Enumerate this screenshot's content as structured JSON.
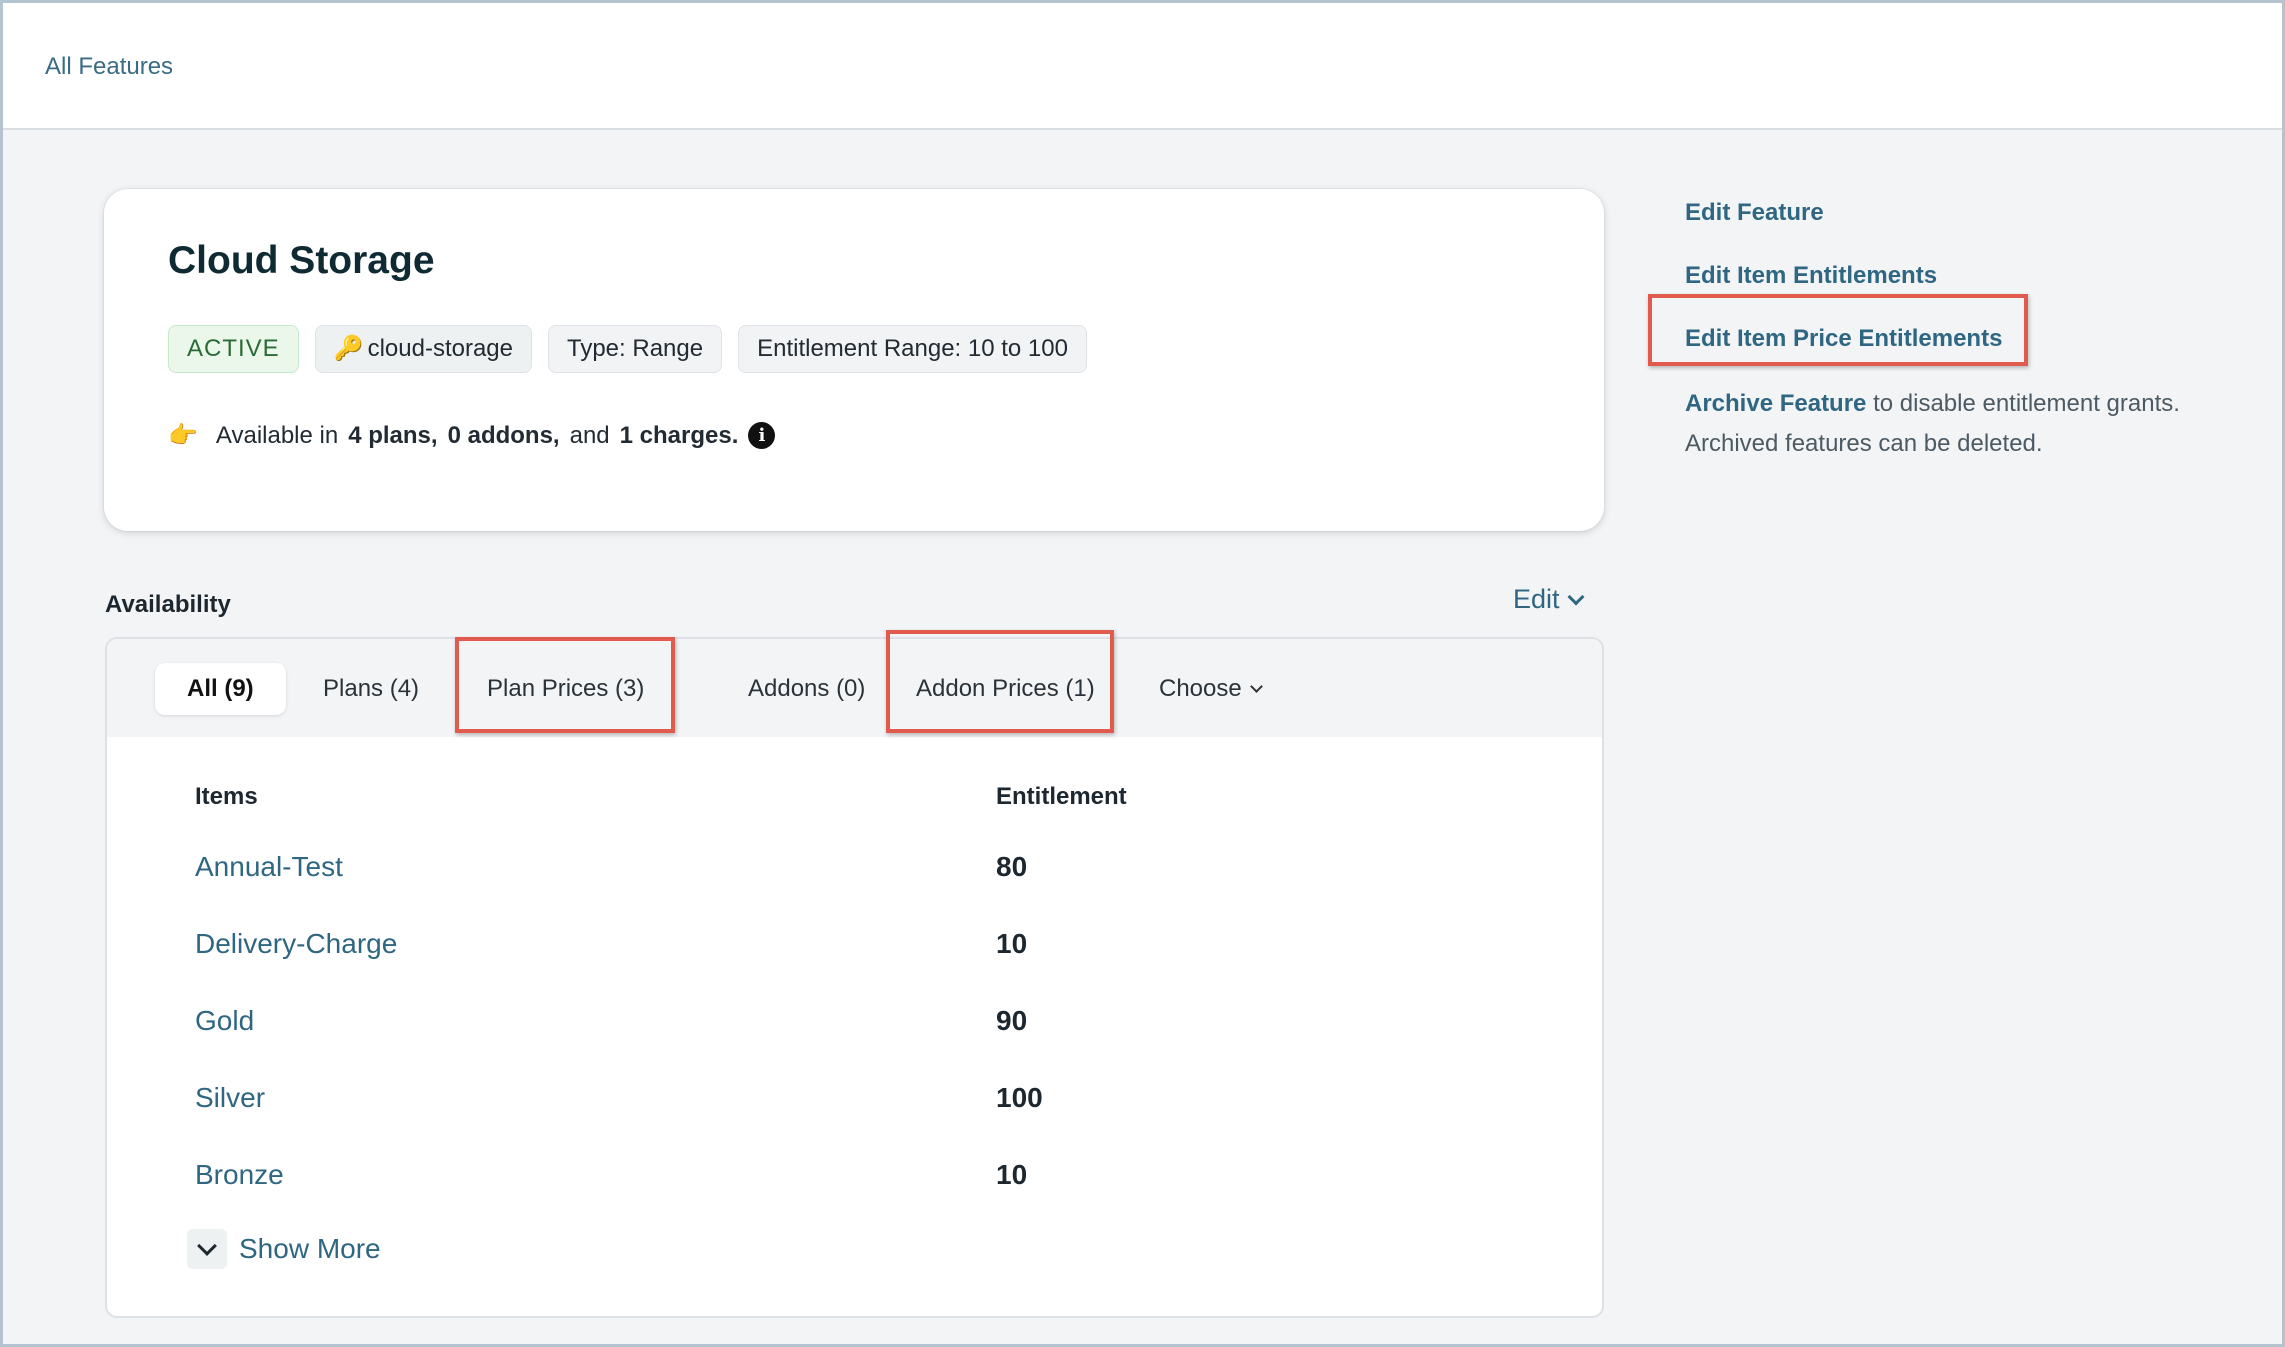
{
  "breadcrumb": {
    "label": "All Features"
  },
  "feature": {
    "title": "Cloud Storage",
    "status": "ACTIVE",
    "key": "cloud-storage",
    "type": "Type: Range",
    "range": "Entitlement Range: 10 to 100",
    "availability": {
      "prefix": "Available in",
      "plans": "4 plans,",
      "addons": "0 addons,",
      "and": "and",
      "charges": "1 charges."
    }
  },
  "sidebar": {
    "edit_feature": "Edit Feature",
    "edit_item_entitlements": "Edit Item Entitlements",
    "edit_item_price_entitlements": "Edit Item Price Entitlements",
    "archive_link": "Archive Feature",
    "archive_text": " to disable entitlement grants. Archived features can be deleted."
  },
  "availability_section": {
    "title": "Availability",
    "edit_label": "Edit",
    "tabs": [
      "All (9)",
      "Plans (4)",
      "Plan Prices (3)",
      "Addons (0)",
      "Addon Prices (1)",
      "Choose"
    ],
    "selected_tab": "All (9)",
    "columns": [
      "Items",
      "Entitlement"
    ],
    "rows": [
      {
        "item": "Annual-Test",
        "entitlement": "80"
      },
      {
        "item": "Delivery-Charge",
        "entitlement": "10"
      },
      {
        "item": "Gold",
        "entitlement": "90"
      },
      {
        "item": "Silver",
        "entitlement": "100"
      },
      {
        "item": "Bronze",
        "entitlement": "10"
      }
    ],
    "show_more": "Show More"
  },
  "icons": {
    "key": "key-icon",
    "pointer": "pointing-hand-icon",
    "info": "info-icon",
    "chevron": "chevron-down-icon"
  },
  "colors": {
    "accent": "#2f6782",
    "highlight": "#e05a4e",
    "active_badge": "#eaf7ea"
  }
}
